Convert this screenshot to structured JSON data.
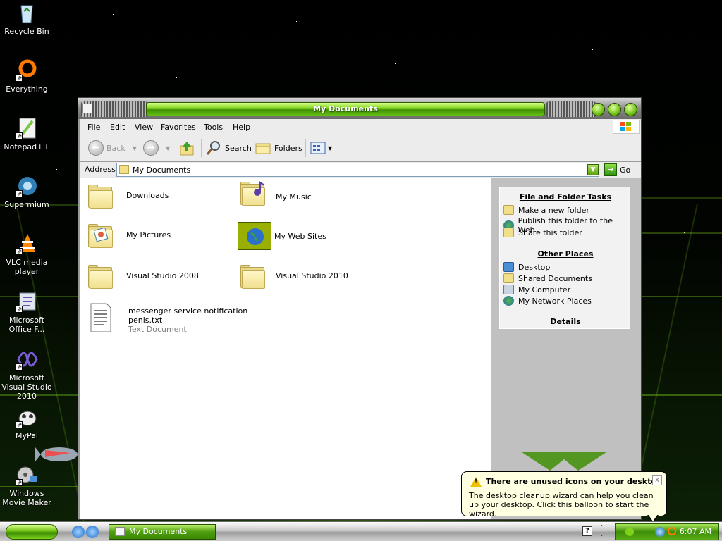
{
  "desktop": {
    "icons": [
      {
        "label": "Recycle Bin",
        "icon": "recycle-bin-icon"
      },
      {
        "label": "Everything",
        "icon": "everything-icon"
      },
      {
        "label": "Notepad++",
        "icon": "notepad-plus-plus-icon"
      },
      {
        "label": "Supermium",
        "icon": "supermium-icon"
      },
      {
        "label": "VLC media player",
        "icon": "vlc-icon"
      },
      {
        "label": "Microsoft Office F...",
        "icon": "office-icon"
      },
      {
        "label": "Microsoft Visual Studio 2010",
        "icon": "visual-studio-icon"
      },
      {
        "label": "MyPal",
        "icon": "mypal-icon"
      },
      {
        "label": "Windows Movie Maker",
        "icon": "movie-maker-icon"
      }
    ]
  },
  "window": {
    "title": "My Documents",
    "menu": [
      "File",
      "Edit",
      "View",
      "Favorites",
      "Tools",
      "Help"
    ],
    "toolbar": {
      "back": "Back",
      "search": "Search",
      "folders": "Folders"
    },
    "address": {
      "label": "Address",
      "value": "My Documents",
      "go": "Go"
    },
    "files": [
      {
        "name": "Downloads",
        "type": "folder"
      },
      {
        "name": "My Music",
        "type": "folder"
      },
      {
        "name": "My Pictures",
        "type": "folder"
      },
      {
        "name": "My Web Sites",
        "type": "folder"
      },
      {
        "name": "Visual Studio 2008",
        "type": "folder"
      },
      {
        "name": "Visual Studio 2010",
        "type": "folder"
      },
      {
        "name_line1": "messenger service notification",
        "name_line2": "penis.txt",
        "subtitle": "Text Document",
        "type": "text"
      }
    ],
    "taskpane": {
      "file_tasks_title": "File and Folder Tasks",
      "file_tasks": [
        {
          "label": "Make a new folder",
          "icon": "new-folder-icon"
        },
        {
          "label": "Publish this folder to the Web",
          "icon": "globe-icon"
        },
        {
          "label": "Share this folder",
          "icon": "share-folder-icon"
        }
      ],
      "other_places_title": "Other Places",
      "other_places": [
        {
          "label": "Desktop",
          "icon": "desktop-icon"
        },
        {
          "label": "Shared Documents",
          "icon": "shared-documents-icon"
        },
        {
          "label": "My Computer",
          "icon": "my-computer-icon"
        },
        {
          "label": "My Network Places",
          "icon": "network-places-icon"
        }
      ],
      "details_title": "Details"
    }
  },
  "balloon": {
    "title": "There are unused icons on your desktop",
    "body": "The desktop cleanup wizard can help you clean up your desktop. Click this balloon to start the wizard.",
    "close": "x"
  },
  "taskbar": {
    "task_label": "My Documents",
    "clock": "6:07 AM"
  },
  "colors": {
    "accent_green": "#5aa10c",
    "balloon_bg": "#ffffe1"
  }
}
